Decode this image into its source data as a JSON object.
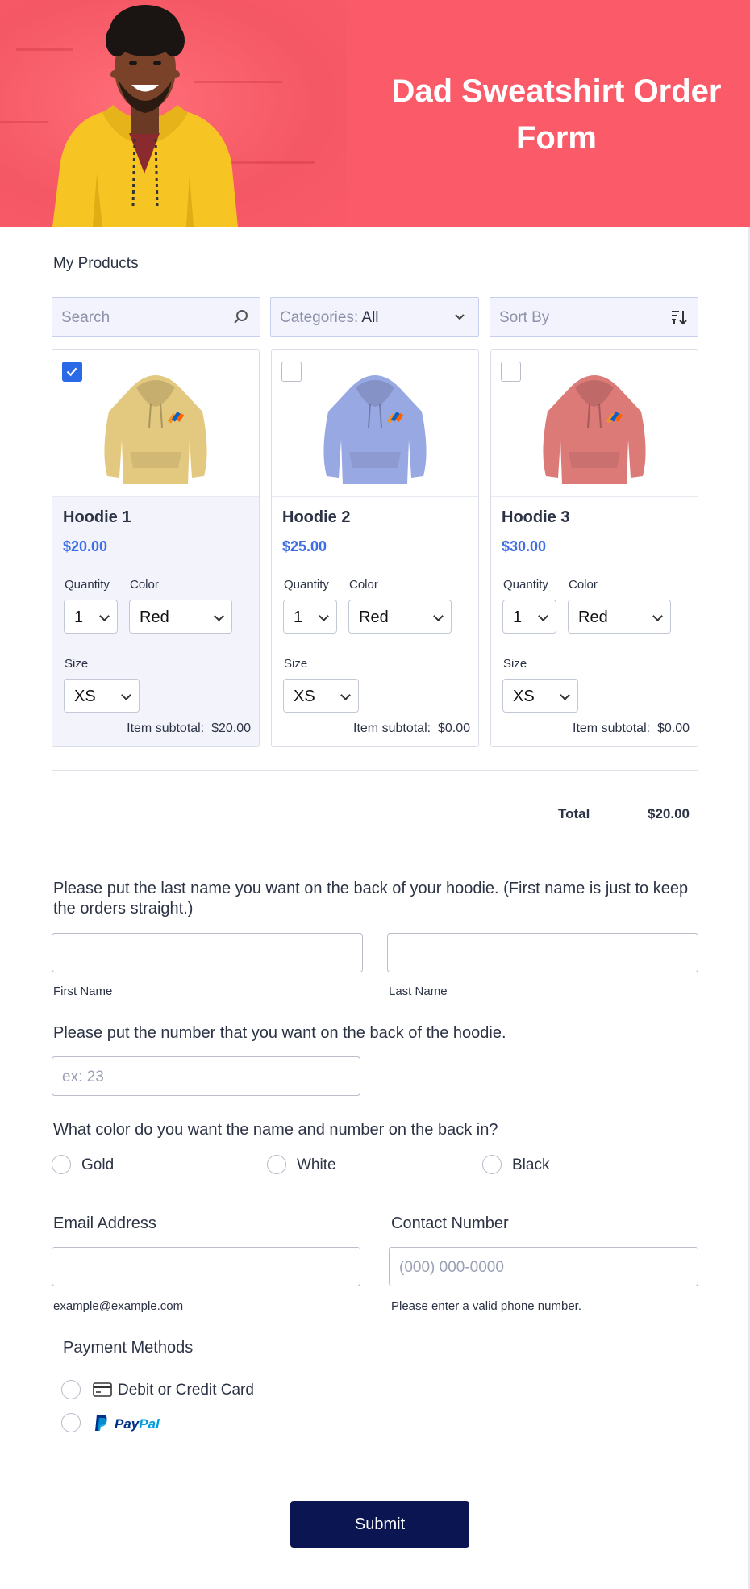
{
  "header": {
    "title_line1": "Dad Sweatshirt Order",
    "title_line2": "Form"
  },
  "products": {
    "section_label": "My Products",
    "search_placeholder": "Search",
    "categories_label": "Categories:",
    "categories_value": "All",
    "sort_label": "Sort By",
    "items": [
      {
        "name": "Hoodie 1",
        "price": "$20.00",
        "selected": true,
        "color_hex": "#e3c87f",
        "quantity_label": "Quantity",
        "quantity": "1",
        "color_label": "Color",
        "color": "Red",
        "size_label": "Size",
        "size": "XS",
        "subtotal_label": "Item subtotal:",
        "subtotal": "$20.00"
      },
      {
        "name": "Hoodie 2",
        "price": "$25.00",
        "selected": false,
        "color_hex": "#98a8e3",
        "quantity_label": "Quantity",
        "quantity": "1",
        "color_label": "Color",
        "color": "Red",
        "size_label": "Size",
        "size": "XS",
        "subtotal_label": "Item subtotal:",
        "subtotal": "$0.00"
      },
      {
        "name": "Hoodie 3",
        "price": "$30.00",
        "selected": false,
        "color_hex": "#dc7a78",
        "quantity_label": "Quantity",
        "quantity": "1",
        "color_label": "Color",
        "color": "Red",
        "size_label": "Size",
        "size": "XS",
        "subtotal_label": "Item subtotal:",
        "subtotal": "$0.00"
      }
    ],
    "total_label": "Total",
    "total_value": "$20.00"
  },
  "name_question": {
    "text": "Please put the last name you want on the back of your hoodie. (First name is just to keep the orders straight.)",
    "first_sublabel": "First Name",
    "last_sublabel": "Last Name"
  },
  "number_question": {
    "text": "Please put the number that you want on the back of the hoodie.",
    "placeholder": "ex: 23"
  },
  "color_question": {
    "text": "What color do you want the name and number on the back in?",
    "options": [
      "Gold",
      "White",
      "Black"
    ]
  },
  "email": {
    "label": "Email Address",
    "sublabel": "example@example.com"
  },
  "phone": {
    "label": "Contact Number",
    "placeholder": "(000) 000-0000",
    "sublabel": "Please enter a valid phone number."
  },
  "payment": {
    "label": "Payment Methods",
    "card_label": "Debit or Credit Card",
    "paypal_label_1": "Pay",
    "paypal_label_2": "Pal"
  },
  "submit_label": "Submit",
  "colors": {
    "header_bg": "#fb5a68",
    "accent": "#3e6ee6",
    "submit_bg": "#0a1551"
  }
}
